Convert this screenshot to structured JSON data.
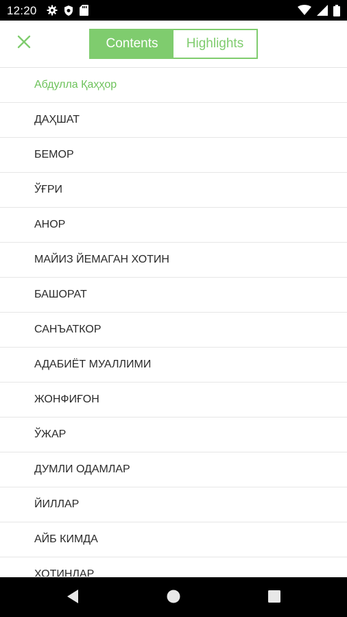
{
  "status_bar": {
    "time": "12:20",
    "icons_left": [
      "gear-icon",
      "shield-icon",
      "sd-card-icon"
    ],
    "icons_right": [
      "wifi-icon",
      "signal-icon",
      "battery-icon"
    ]
  },
  "toolbar": {
    "close_icon": "close-icon",
    "tabs": [
      {
        "label": "Contents",
        "active": true
      },
      {
        "label": "Highlights",
        "active": false
      }
    ],
    "accent_color": "#7fcc6e"
  },
  "toc": {
    "items": [
      {
        "label": "Абдулла Қаҳҳор",
        "current": true
      },
      {
        "label": "ДАҲШАТ"
      },
      {
        "label": "БЕМОР"
      },
      {
        "label": "ЎҒРИ"
      },
      {
        "label": "АНОР"
      },
      {
        "label": "МАЙИЗ ЙЕМАГАН ХОТИН"
      },
      {
        "label": "БАШОРАТ"
      },
      {
        "label": "САНЪАТКОР"
      },
      {
        "label": "АДАБИЁТ МУАЛЛИМИ"
      },
      {
        "label": "ЖОНФИҒОН"
      },
      {
        "label": "ЎЖАР"
      },
      {
        "label": "ДУМЛИ ОДАМЛАР"
      },
      {
        "label": "ЙИЛЛАР"
      },
      {
        "label": "АЙБ КИМДА"
      },
      {
        "label": "ХОТИНЛАР"
      }
    ]
  },
  "nav_bar": {
    "buttons": [
      "back-icon",
      "home-icon",
      "recents-icon"
    ]
  }
}
